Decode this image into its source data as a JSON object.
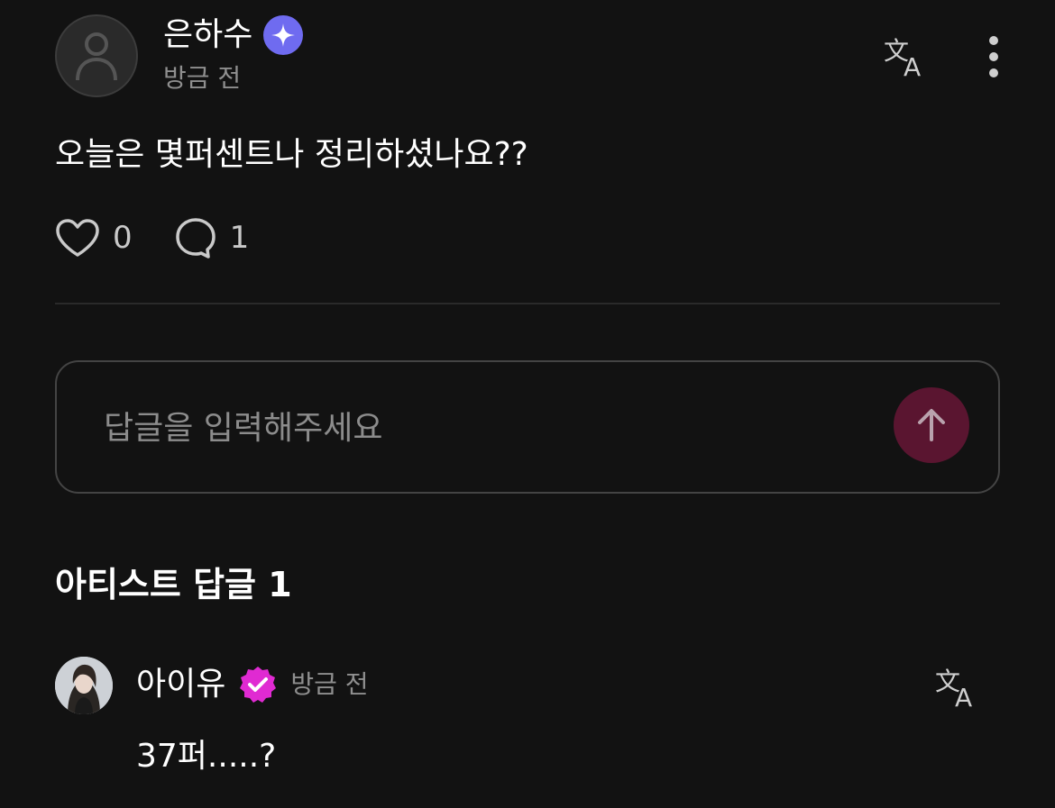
{
  "post": {
    "author_name": "은하수",
    "time": "방금 전",
    "body": "오늘은 몇퍼센트나 정리하셨나요??",
    "like_count": "0",
    "comment_count": "1"
  },
  "reply_input": {
    "placeholder": "답글을 입력해주세요"
  },
  "artist_replies": {
    "title": "아티스트 답글 1",
    "items": [
      {
        "name": "아이유",
        "time": "방금 전",
        "text": "37퍼.....?"
      }
    ]
  },
  "colors": {
    "background": "#121212",
    "sparkle_badge": "#6f6bf0",
    "verified_badge": "#e02ad2",
    "send_button": "#5a1530",
    "muted_text": "#8f8f8f"
  }
}
